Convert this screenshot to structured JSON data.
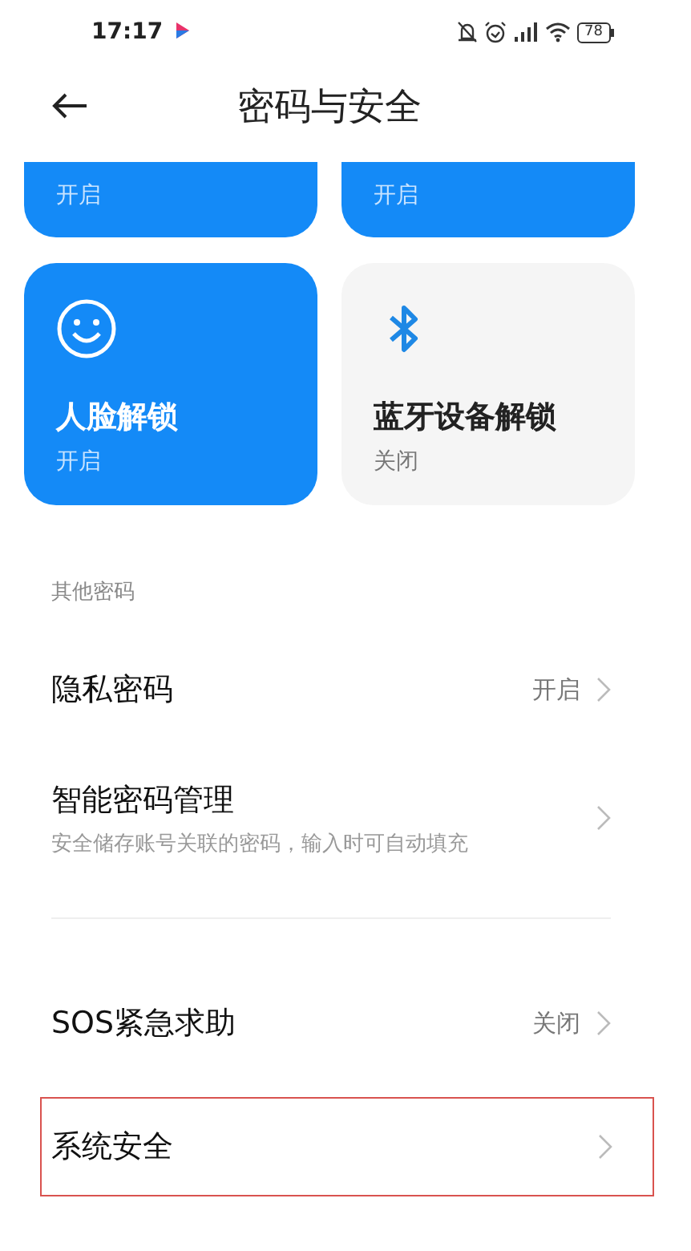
{
  "status_bar": {
    "time": "17:17",
    "battery": "78"
  },
  "header": {
    "title": "密码与安全"
  },
  "tiles": [
    {
      "kind": "cut",
      "status": "开启",
      "on": true
    },
    {
      "kind": "cut",
      "status": "开启",
      "on": true
    },
    {
      "kind": "face",
      "title": "人脸解锁",
      "status": "开启",
      "on": true
    },
    {
      "kind": "bluetooth",
      "title": "蓝牙设备解锁",
      "status": "关闭",
      "on": false
    }
  ],
  "section_label": "其他密码",
  "rows": [
    {
      "title": "隐私密码",
      "value": "开启",
      "highlighted": false,
      "divider_after": false
    },
    {
      "title": "智能密码管理",
      "subtitle": "安全储存账号关联的密码，输入时可自动填充",
      "highlighted": false,
      "divider_after": true
    },
    {
      "title": "SOS紧急求助",
      "value": "关闭",
      "highlighted": false,
      "divider_after": false
    },
    {
      "title": "系统安全",
      "highlighted": true,
      "divider_after": false
    }
  ]
}
